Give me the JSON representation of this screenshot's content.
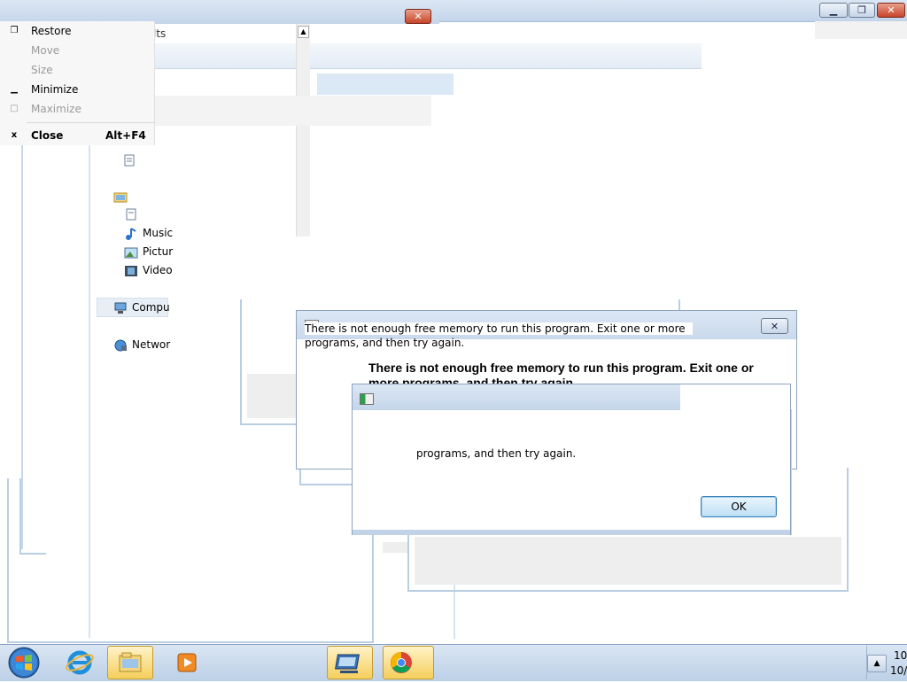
{
  "system_menu": {
    "items": [
      {
        "icon": "restore-icon",
        "label": "Restore",
        "enabled": true,
        "accel": ""
      },
      {
        "icon": "",
        "label": "Move",
        "enabled": false,
        "accel": ""
      },
      {
        "icon": "",
        "label": "Size",
        "enabled": false,
        "accel": ""
      },
      {
        "icon": "minimize-icon",
        "label": "Minimize",
        "enabled": true,
        "accel": ""
      },
      {
        "icon": "maximize-icon",
        "label": "Maximize",
        "enabled": false,
        "accel": ""
      },
      {
        "icon": "close-x-icon",
        "label": "Close",
        "enabled": true,
        "accel": "Alt+F4"
      }
    ],
    "close_glyph": "x"
  },
  "explorer": {
    "address_fragment": "lts",
    "nav_items": [
      {
        "icon": "document-icon",
        "label": ""
      },
      {
        "icon": "libraries-folder-icon",
        "label": ""
      },
      {
        "icon": "documents-icon",
        "label": ""
      },
      {
        "icon": "music-icon",
        "label": "Music"
      },
      {
        "icon": "pictures-icon",
        "label": "Pictur"
      },
      {
        "icon": "videos-icon",
        "label": "Video"
      },
      {
        "icon": "computer-icon",
        "label": "Compu"
      },
      {
        "icon": "network-icon",
        "label": "Networ"
      }
    ]
  },
  "dialog_back": {
    "message_line1": "There is not enough free memory to run this program. Exit one or more",
    "message_line2": "programs, and then try again.",
    "bold_line1": "There is not enough free memory to run this program. Exit one or",
    "bold_line2": "more programs, and then try again."
  },
  "dialog_front": {
    "message": "programs, and then try again.",
    "ok_label": "OK"
  },
  "taskbar": {
    "clock_line1": "10",
    "clock_line2": "10/",
    "pinned": [
      "start-orb-icon",
      "internet-explorer-icon",
      "explorer-folder-icon",
      "media-player-icon",
      "remote-desktop-icon",
      "chrome-icon"
    ]
  },
  "colors": {
    "taskbar": "#c9d9ec",
    "window_border": "#b9cde3",
    "close_red": "#c7442a"
  }
}
